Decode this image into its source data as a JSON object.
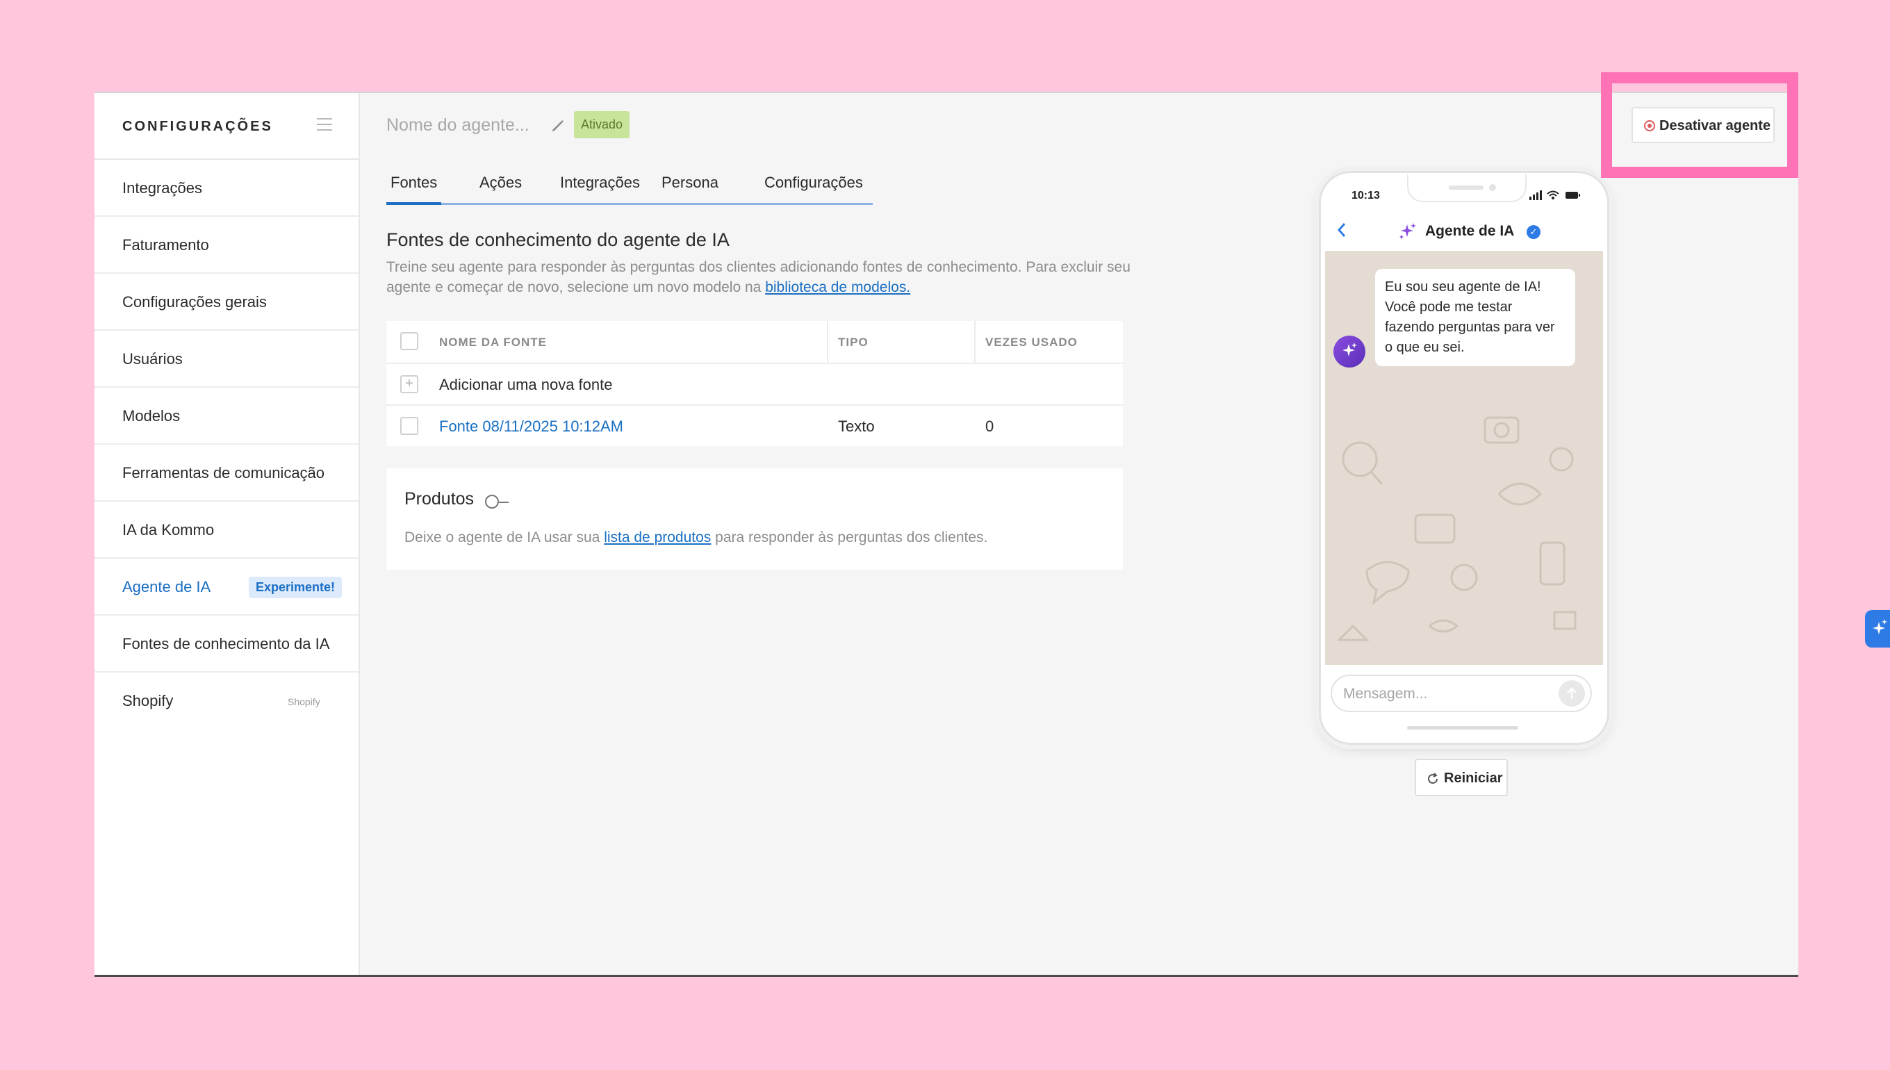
{
  "sidebar": {
    "title": "CONFIGURAÇÕES",
    "items": [
      {
        "label": "Integrações"
      },
      {
        "label": "Faturamento"
      },
      {
        "label": "Configurações gerais"
      },
      {
        "label": "Usuários"
      },
      {
        "label": "Modelos"
      },
      {
        "label": "Ferramentas de comunicação"
      },
      {
        "label": "IA da Kommo"
      },
      {
        "label": "Agente de IA",
        "badge": "Experimente!",
        "active": true
      },
      {
        "label": "Fontes de conhecimento da IA"
      },
      {
        "label": "Shopify",
        "sub": "Shopify"
      }
    ]
  },
  "header": {
    "agent_name_placeholder": "Nome do agente...",
    "status": "Ativado"
  },
  "tabs": [
    "Fontes",
    "Ações",
    "Integrações",
    "Persona",
    "Configurações"
  ],
  "active_tab": "Fontes",
  "section": {
    "title": "Fontes de conhecimento do agente de IA",
    "desc_before": "Treine seu agente para responder às perguntas dos clientes adicionando fontes de conhecimento. Para excluir seu agente e começar de novo, selecione um novo modelo na ",
    "desc_link": "biblioteca de modelos."
  },
  "table": {
    "headers": [
      "NOME DA FONTE",
      "TIPO",
      "VEZES USADO"
    ],
    "add_label": "Adicionar uma nova fonte",
    "rows": [
      {
        "name": "Fonte 08/11/2025 10:12AM",
        "type": "Texto",
        "used": "0"
      }
    ]
  },
  "products": {
    "title": "Produtos",
    "desc_before": "Deixe o agente de IA usar sua ",
    "desc_link": "lista de produtos",
    "desc_after": " para responder às perguntas dos clientes."
  },
  "phone": {
    "time": "10:13",
    "chat_title": "Agente de IA",
    "bot_message": "Eu sou seu agente de IA! Você pode me testar fazendo perguntas para ver o que eu sei.",
    "input_placeholder": "Mensagem..."
  },
  "restart_label": "Reiniciar",
  "deactivate_label": "Desativar agente",
  "colors": {
    "accent": "#1a6fc4",
    "page_background": "#ffc6de",
    "highlight": "#ff72b6",
    "status_bg": "#c8e39a"
  }
}
